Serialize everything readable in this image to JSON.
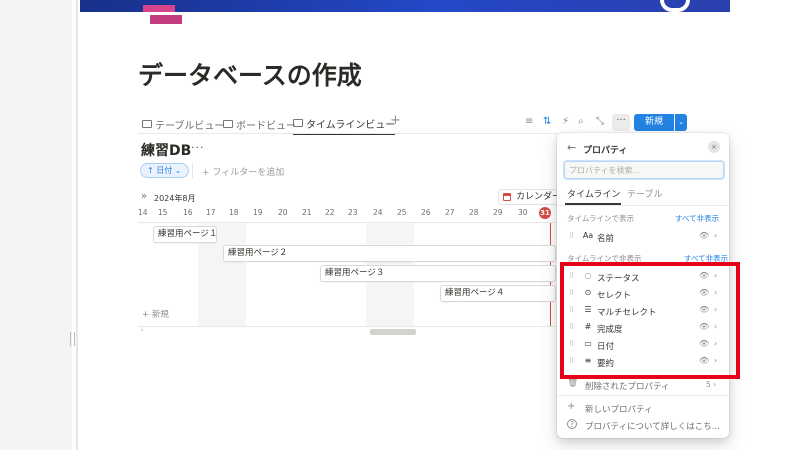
{
  "page": {
    "title": "データベースの作成"
  },
  "tabs": [
    {
      "label": "テーブルビュー",
      "icon": "table-icon"
    },
    {
      "label": "ボードビュー",
      "icon": "board-icon"
    },
    {
      "label": "タイムラインビュー",
      "icon": "timeline-icon",
      "active": true
    }
  ],
  "toolbar": {
    "add_tab": "+",
    "filter_icon": "≡",
    "sort_icon": "⇅",
    "automation_icon": "⚡",
    "search_icon": "⌕",
    "expand_icon": "⤡",
    "more": "···",
    "new_label": "新規",
    "new_dropdown": "⌄"
  },
  "database": {
    "title": "練習DB",
    "more": "···",
    "filter_chip": "↑ 日付 ⌄",
    "add_filter": "+ フィルターを追加"
  },
  "timeline": {
    "expand": "»",
    "month": "2024年8月",
    "calendar_button": "カレンダー",
    "days": [
      "14",
      "15",
      "16",
      "17",
      "18",
      "19",
      "20",
      "21",
      "22",
      "23",
      "24",
      "25",
      "26",
      "27",
      "28",
      "29",
      "30",
      "31"
    ],
    "today": "31",
    "items": [
      {
        "label": "練習用ページ１"
      },
      {
        "label": "練習用ページ２"
      },
      {
        "label": "練習用ページ３"
      },
      {
        "label": "練習用ページ４"
      }
    ],
    "new_label": "+ 新規",
    "scroll_left": "‹"
  },
  "panel": {
    "back": "←",
    "title": "プロパティ",
    "close": "×",
    "search_placeholder": "プロパティを検索...",
    "tabs": [
      "タイムライン",
      "テーブル"
    ],
    "shown_section": "タイムラインで表示",
    "hide_all": "すべて非表示",
    "shown": [
      {
        "icon": "Aa",
        "label": "名前"
      }
    ],
    "hidden_section": "タイムラインで非表示",
    "show_all": "すべて非表示",
    "hidden": [
      {
        "icon": "◌",
        "label": "ステータス"
      },
      {
        "icon": "⊙",
        "label": "セレクト"
      },
      {
        "icon": "☰",
        "label": "マルチセレクト"
      },
      {
        "icon": "#",
        "label": "完成度"
      },
      {
        "icon": "▭",
        "label": "日付"
      },
      {
        "icon": "≡",
        "label": "要約"
      }
    ],
    "deleted": {
      "icon": "🗑",
      "label": "削除されたプロパティ",
      "count": "5 ›"
    },
    "new_property": {
      "icon": "+",
      "label": "新しいプロパティ"
    },
    "help": {
      "icon": "?",
      "label": "プロパティについて詳しくはこち..."
    },
    "eye": "👁",
    "chevron": "›",
    "grip": "⠿"
  },
  "colors": {
    "accent": "#2383e2",
    "highlight": "#e8001b",
    "today": "#d44c47"
  }
}
